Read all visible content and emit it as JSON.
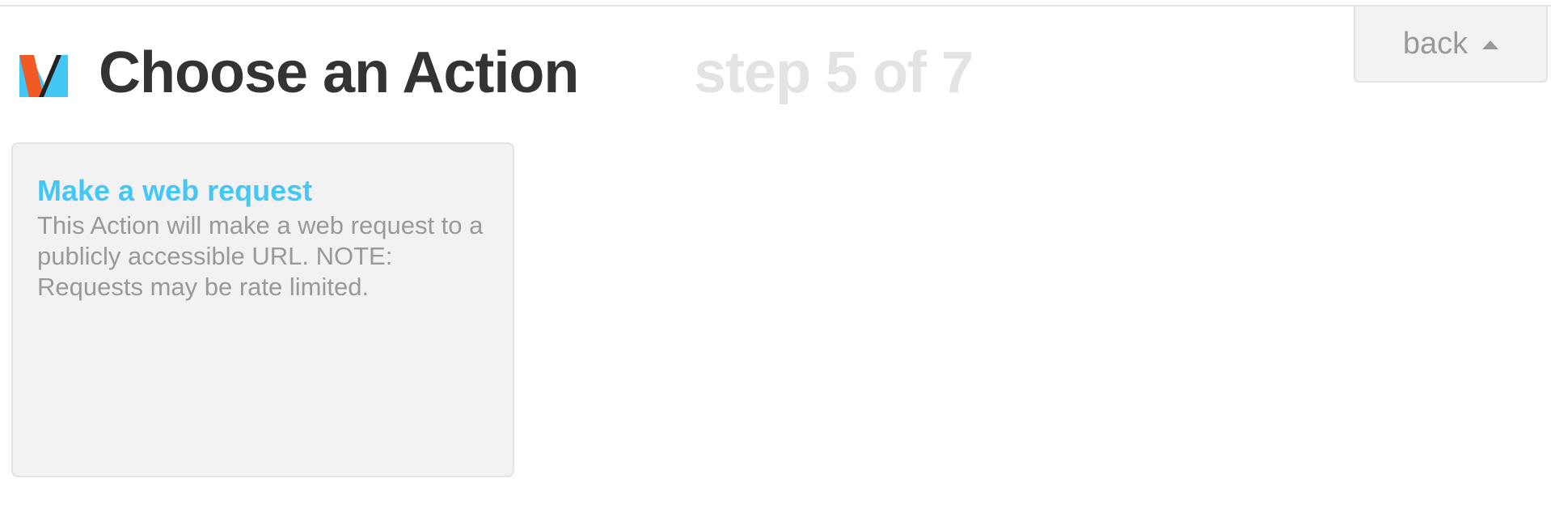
{
  "header": {
    "title": "Choose an Action",
    "step": "step 5 of 7",
    "logo_icon": "maker-m-logo-icon",
    "back_label": "back",
    "back_icon": "caret-up-icon"
  },
  "actions": [
    {
      "title": "Make a web request",
      "description": "This Action will make a web request to a publicly accessible URL. NOTE: Requests may be rate limited."
    }
  ],
  "colors": {
    "title": "#333333",
    "step": "#e3e3e3",
    "accent": "#44c7f4",
    "muted_text": "#999999",
    "card_bg": "#f2f2f2",
    "logo_orange": "#f15a24",
    "logo_blue": "#44c7f4",
    "logo_dark": "#222222"
  }
}
